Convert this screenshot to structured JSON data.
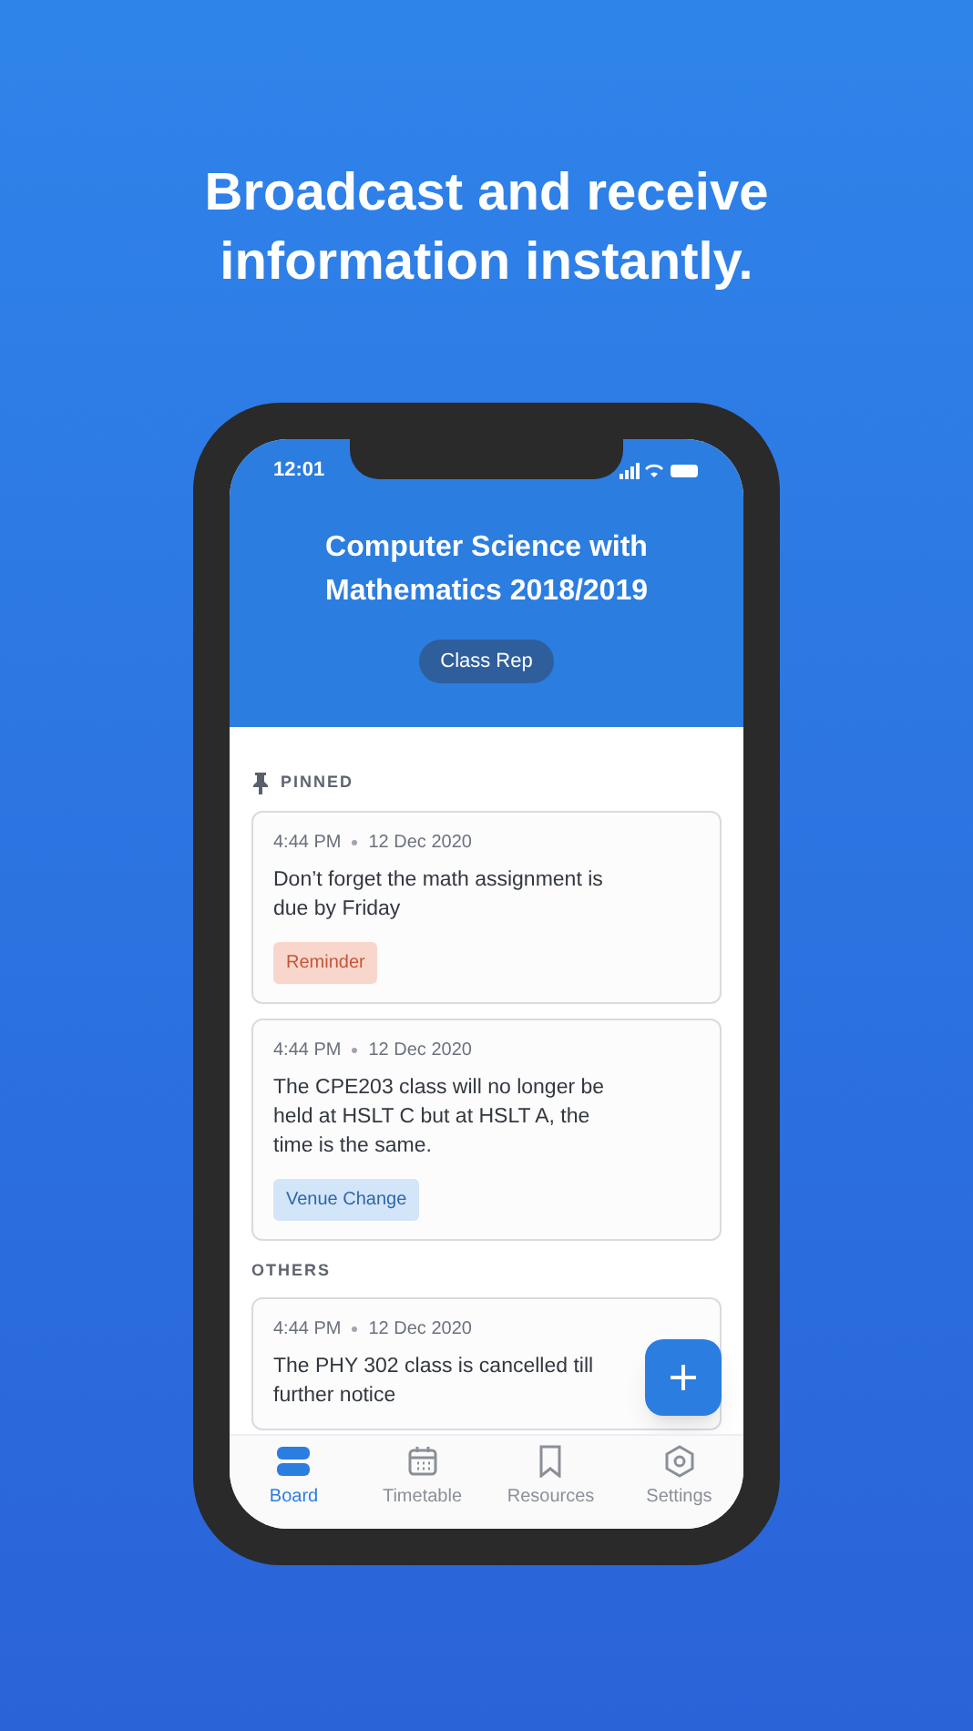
{
  "headline": "Broadcast and receive information instantly.",
  "status_bar": {
    "time": "12:01"
  },
  "header": {
    "title": "Computer Science with Mathematics 2018/2019",
    "role": "Class Rep"
  },
  "sections": [
    {
      "title": "PINNED",
      "pinned": true,
      "posts": [
        {
          "time": "4:44 PM",
          "date": "12 Dec 2020",
          "text": "Don’t forget the math assignment is due by Friday",
          "tag": {
            "label": "Reminder",
            "kind": "reminder"
          }
        },
        {
          "time": "4:44 PM",
          "date": "12 Dec 2020",
          "text": "The CPE203 class will no longer be held at HSLT C but at HSLT A, the time is the same.",
          "tag": {
            "label": "Venue Change",
            "kind": "venue"
          }
        }
      ]
    },
    {
      "title": "OTHERS",
      "pinned": false,
      "posts": [
        {
          "time": "4:44 PM",
          "date": "12 Dec 2020",
          "text": "The PHY 302 class is cancelled till further notice"
        }
      ]
    }
  ],
  "nav": [
    {
      "label": "Board",
      "kind": "board",
      "selected": true
    },
    {
      "label": "Timetable",
      "kind": "calendar",
      "selected": false
    },
    {
      "label": "Resources",
      "kind": "bookmark",
      "selected": false
    },
    {
      "label": "Settings",
      "kind": "settings",
      "selected": false
    }
  ]
}
